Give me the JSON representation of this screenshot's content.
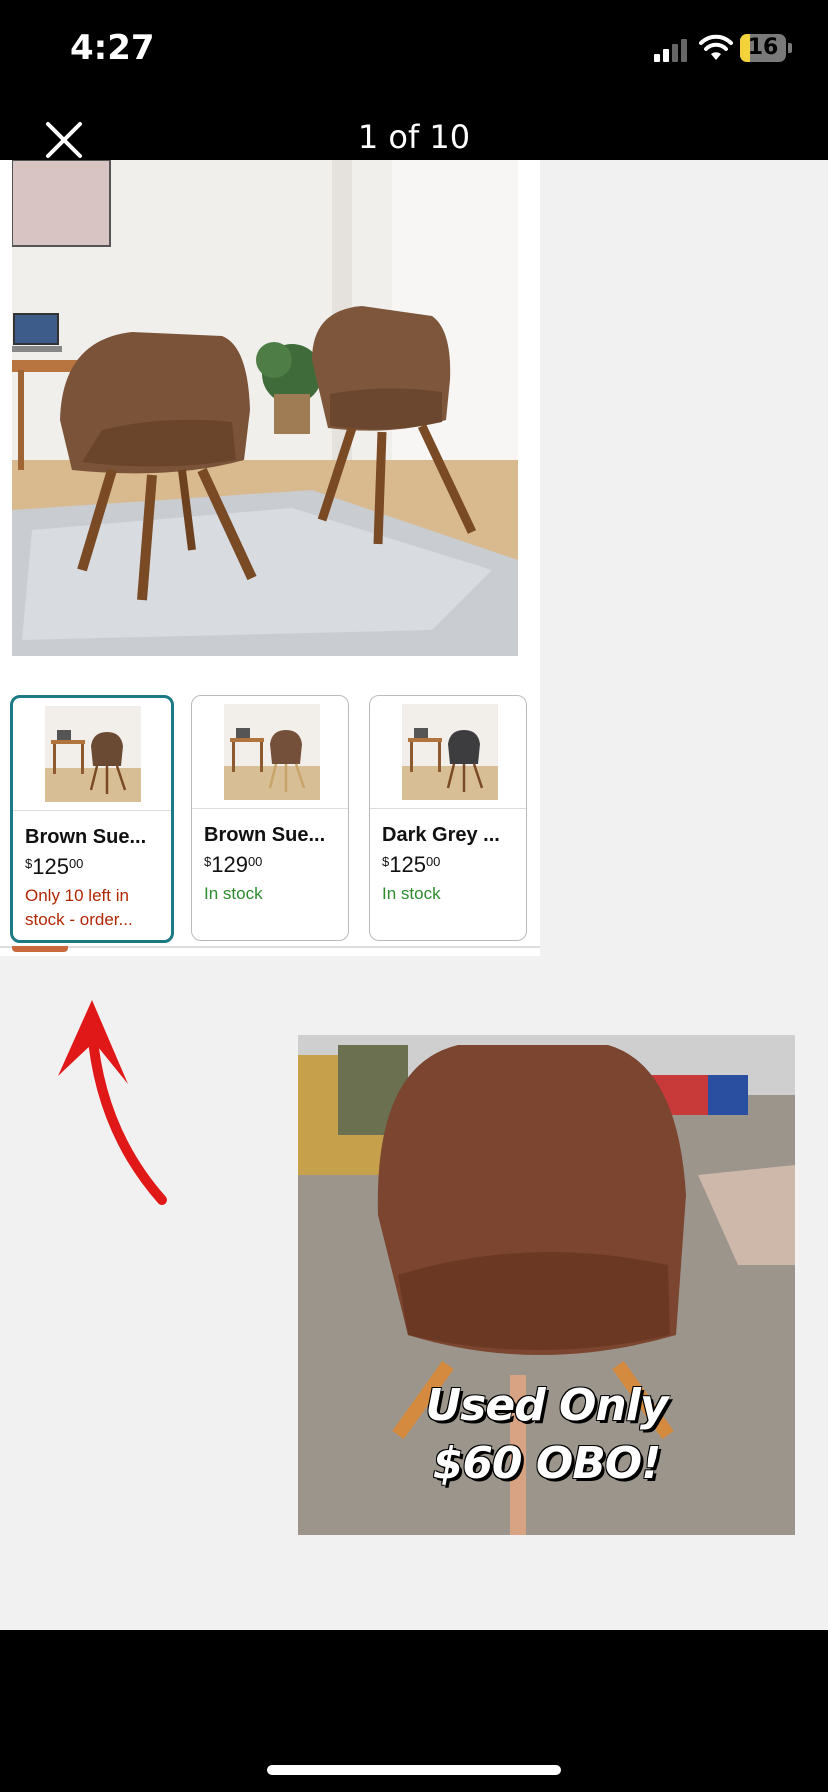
{
  "status_bar": {
    "time": "4:27",
    "battery_level": "16"
  },
  "viewer": {
    "counter": "1 of 10"
  },
  "products": [
    {
      "title": "Brown Sue...",
      "price_currency": "$",
      "price_whole": "125",
      "price_fraction": "00",
      "stock": "Only 10 left in stock - order...",
      "stock_status": "low",
      "selected": true,
      "chair_color": "#6b4a34"
    },
    {
      "title": "Brown Sue...",
      "price_currency": "$",
      "price_whole": "129",
      "price_fraction": "00",
      "stock": "In stock",
      "stock_status": "in",
      "selected": false,
      "chair_color": "#74503a"
    },
    {
      "title": "Dark Grey ...",
      "price_currency": "$",
      "price_whole": "125",
      "price_fraction": "00",
      "stock": "In stock",
      "stock_status": "in",
      "selected": false,
      "chair_color": "#3d3d40"
    }
  ],
  "overlay_text": {
    "line1": "Used Only",
    "line2": "$60 OBO!"
  },
  "colors": {
    "accent_selected": "#1b7a86",
    "low_stock": "#b12704",
    "in_stock": "#2e8b2e",
    "arrow": "#e01818",
    "carousel_indicator": "#c7693b"
  }
}
